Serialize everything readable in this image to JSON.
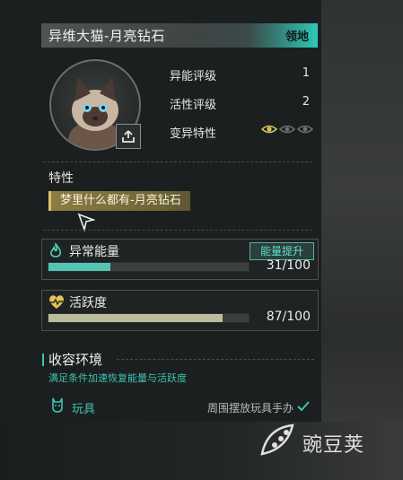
{
  "header": {
    "title": "异维大猫-月亮钻石",
    "tag": "领地"
  },
  "stats": [
    {
      "label": "异能评级",
      "value": "1"
    },
    {
      "label": "活性评级",
      "value": "2"
    },
    {
      "label": "变异特性",
      "value": ""
    }
  ],
  "mutation_eyes": {
    "active": 1,
    "total": 3
  },
  "trait": {
    "section_label": "特性",
    "value": "梦里什么都有-月亮钻石"
  },
  "energy": {
    "label": "异常能量",
    "button": "能量提升",
    "value_text": "31/100",
    "fraction": 0.31,
    "color": "#52c6b3"
  },
  "activity": {
    "label": "活跃度",
    "value_text": "87/100",
    "fraction": 0.87,
    "color": "#b9bd9c"
  },
  "environment": {
    "title": "收容环境",
    "description": "满足条件加速恢复能量与活跃度",
    "item_label": "玩具",
    "requirement": "周围摆放玩具手办"
  },
  "watermark": "豌豆荚"
}
